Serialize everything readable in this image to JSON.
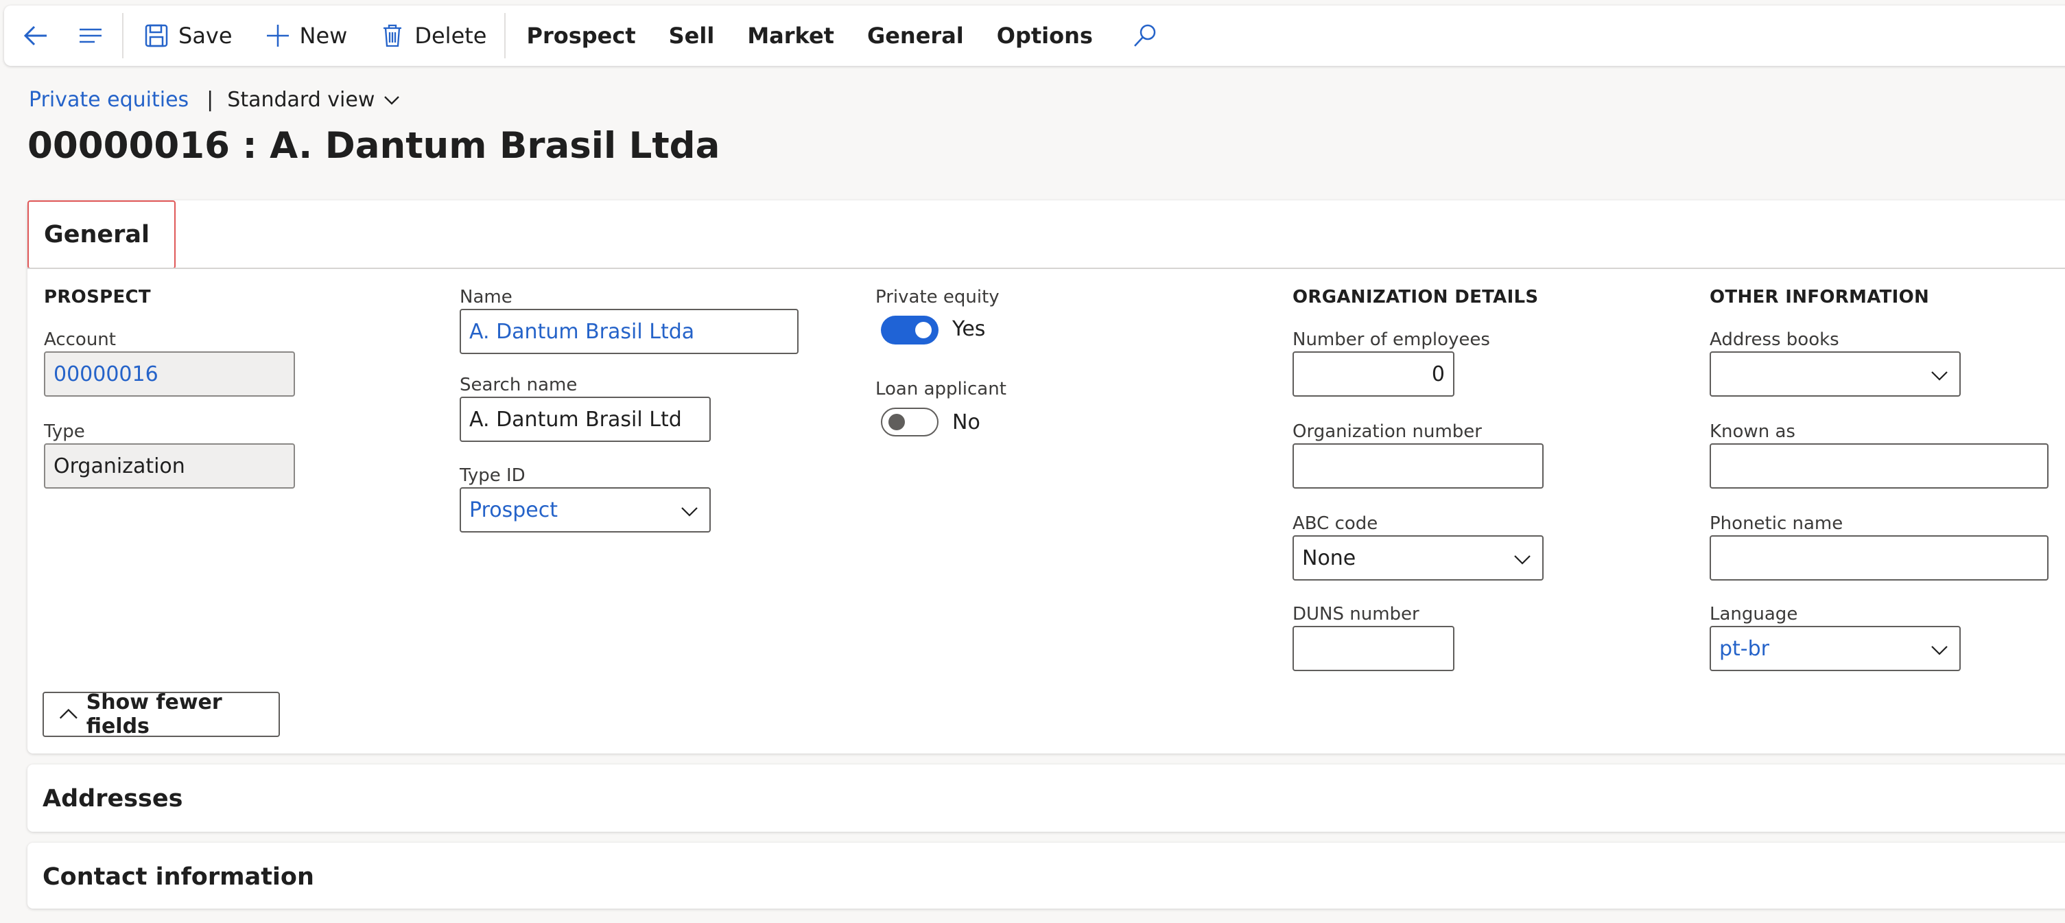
{
  "toolbar": {
    "save_label": "Save",
    "new_label": "New",
    "delete_label": "Delete",
    "menus": [
      "Prospect",
      "Sell",
      "Market",
      "General",
      "Options"
    ]
  },
  "breadcrumb": {
    "link": "Private equities",
    "separator": "|",
    "view": "Standard view"
  },
  "page_title": "00000016 : A. Dantum Brasil Ltda",
  "general": {
    "tab_label": "General",
    "prospect": {
      "heading": "PROSPECT",
      "account_label": "Account",
      "account_value": "00000016",
      "type_label": "Type",
      "type_value": "Organization"
    },
    "name_col": {
      "name_label": "Name",
      "name_value": "A. Dantum Brasil Ltda",
      "search_label": "Search name",
      "search_value": "A. Dantum Brasil Ltd",
      "typeid_label": "Type ID",
      "typeid_value": "Prospect"
    },
    "flags": {
      "private_equity_label": "Private equity",
      "private_equity_value": "Yes",
      "loan_label": "Loan applicant",
      "loan_value": "No"
    },
    "org": {
      "heading": "ORGANIZATION DETAILS",
      "employees_label": "Number of employees",
      "employees_value": "0",
      "orgnum_label": "Organization number",
      "orgnum_value": "",
      "abc_label": "ABC code",
      "abc_value": "None",
      "duns_label": "DUNS number",
      "duns_value": ""
    },
    "other": {
      "heading": "OTHER INFORMATION",
      "addressbooks_label": "Address books",
      "addressbooks_value": "",
      "knownas_label": "Known as",
      "knownas_value": "",
      "phonetic_label": "Phonetic name",
      "phonetic_value": "",
      "language_label": "Language",
      "language_value": "pt-br"
    },
    "fewer_fields_label": "Show fewer fields"
  },
  "sections": {
    "addresses": "Addresses",
    "contact": "Contact information"
  },
  "colors": {
    "accent": "#2563c9",
    "toggle_on": "#1f63d6",
    "tab_highlight": "#e05858"
  }
}
